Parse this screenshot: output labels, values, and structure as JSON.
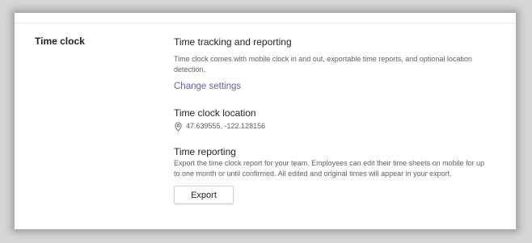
{
  "section": {
    "title": "Time clock"
  },
  "tracking": {
    "heading": "Time tracking and reporting",
    "description": "Time clock comes with mobile clock in and out, exportable time reports, and optional location detection.",
    "change_link": "Change settings"
  },
  "location": {
    "heading": "Time clock location",
    "icon": "location-pin-icon",
    "coordinates": "47.639555, -122.128156"
  },
  "reporting": {
    "heading": "Time reporting",
    "description": "Export the time clock report for your team. Employees can edit their time sheets on mobile for up to one month or until confirmed. All edited and original times will appear in your export.",
    "export_label": "Export"
  },
  "colors": {
    "accent": "#6264a7",
    "text": "#242424",
    "secondary_text": "#616161"
  }
}
